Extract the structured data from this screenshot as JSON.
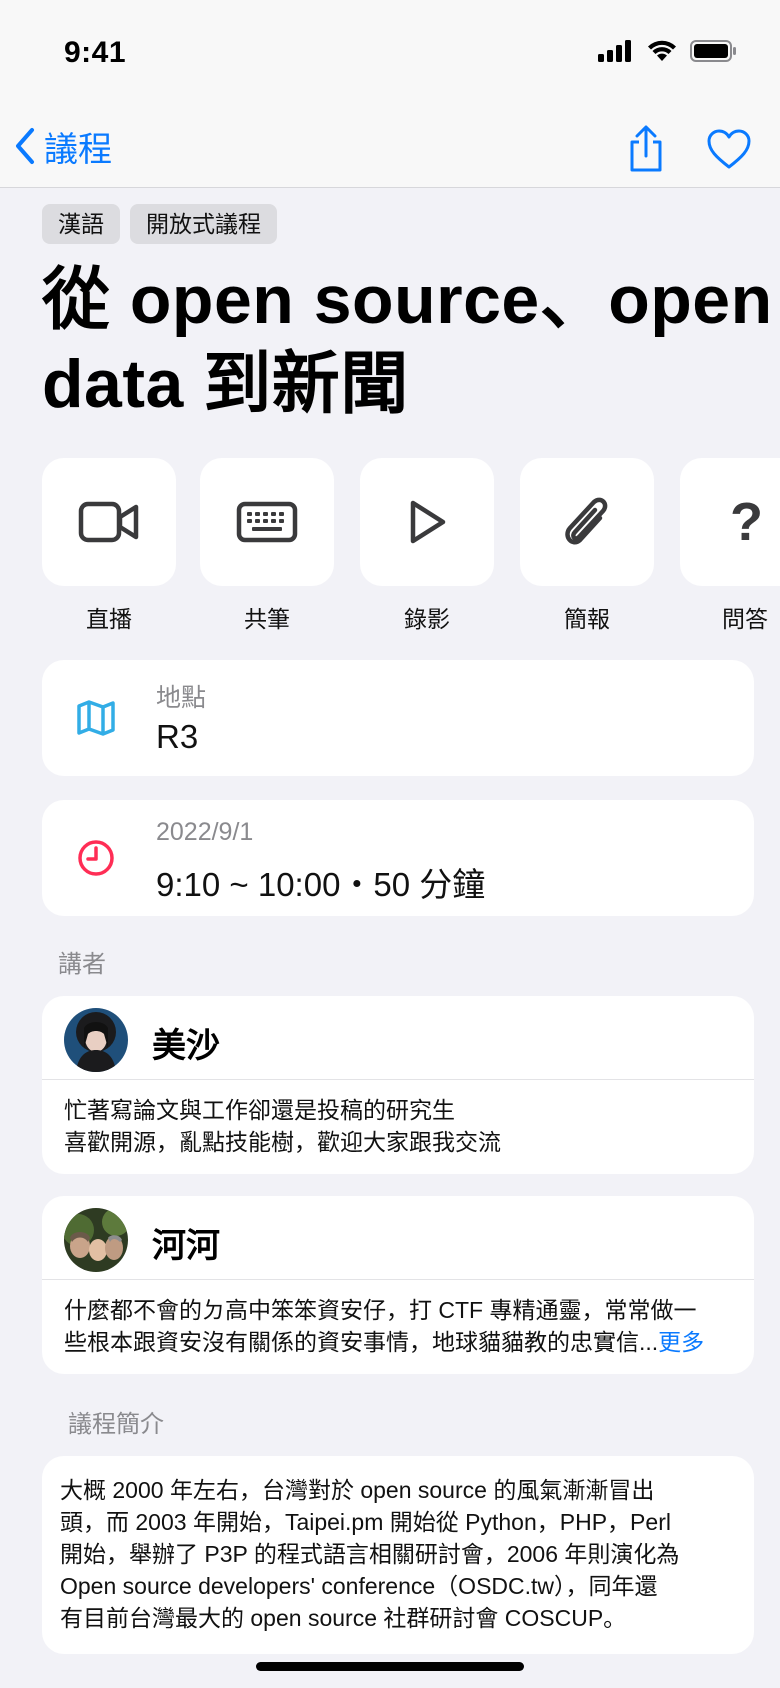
{
  "status_bar": {
    "time": "9:41"
  },
  "nav": {
    "back_label": "議程"
  },
  "tags": [
    "漢語",
    "開放式議程"
  ],
  "session": {
    "title_line1": "從 open source、open",
    "title_line2": "data 到新聞"
  },
  "actions": [
    {
      "label": "直播",
      "icon": "video-camera-icon"
    },
    {
      "label": "共筆",
      "icon": "keyboard-icon"
    },
    {
      "label": "錄影",
      "icon": "play-icon"
    },
    {
      "label": "簡報",
      "icon": "paperclip-icon"
    },
    {
      "label": "問答",
      "icon": "question-icon"
    }
  ],
  "location": {
    "label": "地點",
    "value": "R3"
  },
  "time": {
    "date": "2022/9/1",
    "range": "9:10 ~ 10:00・50 分鐘"
  },
  "speakers_label": "講者",
  "speakers": [
    {
      "name": "美沙",
      "bio_line1": "忙著寫論文與工作卻還是投稿的研究生",
      "bio_line2": "喜歡開源，亂點技能樹，歡迎大家跟我交流"
    },
    {
      "name": "河河",
      "bio_line1": "什麼都不會的ㄉ高中笨笨資安仔，打 CTF 專精通靈，常常做一",
      "bio_line2": "些根本跟資安沒有關係的資安事情，地球貓貓教的忠實信...",
      "more": "更多"
    }
  ],
  "intro_label": "議程簡介",
  "intro_lines": [
    "大概 2000 年左右，台灣對於 open source 的風氣漸漸冒出",
    "頭，而 2003 年開始，Taipei.pm 開始從 Python，PHP，Perl",
    "開始，舉辦了 P3P 的程式語言相關研討會，2006 年則演化為",
    "Open source developers' conference（OSDC.tw），同年還",
    "有目前台灣最大的 open source 社群研討會 COSCUP。"
  ],
  "colors": {
    "accent": "#0a7aff",
    "map_icon": "#32ade6",
    "clock_icon": "#ff2d55"
  }
}
